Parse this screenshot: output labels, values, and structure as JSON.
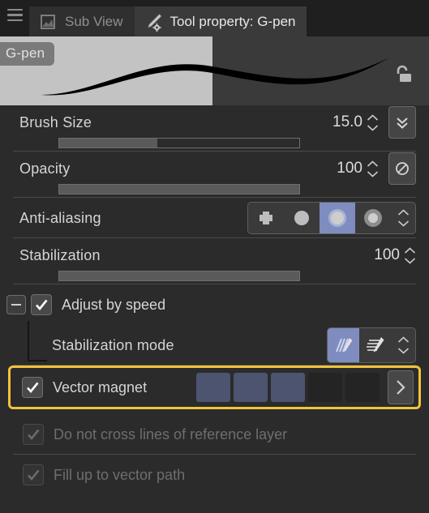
{
  "window": {
    "menu_icon": "hamburger-icon"
  },
  "tabs": [
    {
      "label": "Sub View",
      "icon": "sub-view-icon",
      "active": false
    },
    {
      "label": "Tool property: G-pen",
      "icon": "pencil-gear-icon",
      "active": true
    }
  ],
  "preview": {
    "brush_name": "G-pen",
    "lock_icon": "unlock-icon",
    "left_bg": "#c3c3c3",
    "right_bg": "#3a3a3a",
    "stroke_color": "#000000"
  },
  "properties": [
    {
      "label": "Brush Size",
      "value": "15.0",
      "slider_percent": 41,
      "side_button_icon": "double-chevron-down-icon",
      "has_side_button": true,
      "has_spinner": true
    },
    {
      "label": "Opacity",
      "value": "100",
      "slider_percent": 100,
      "side_button_icon": "no-pressure-icon",
      "has_side_button": true,
      "has_spinner": true
    }
  ],
  "anti_aliasing": {
    "label": "Anti-aliasing",
    "options": [
      {
        "name": "none-icon",
        "selected": false
      },
      {
        "name": "weak-icon",
        "selected": false
      },
      {
        "name": "medium-icon",
        "selected": true
      },
      {
        "name": "strong-icon",
        "selected": false
      }
    ],
    "selected_index": 2,
    "selected_color": "#7e8cc0"
  },
  "stabilization": {
    "label": "Stabilization",
    "value": "100",
    "slider_percent": 100
  },
  "adjust_by_speed": {
    "label": "Adjust by speed",
    "checked": true,
    "expanded": true,
    "collapse_icon": "minus-box-icon"
  },
  "stabilization_mode": {
    "label": "Stabilization mode",
    "options": [
      {
        "name": "stabilizer-lines-icon",
        "selected": true
      },
      {
        "name": "stabilizer-taper-icon",
        "selected": false
      }
    ]
  },
  "vector_magnet": {
    "label": "Vector magnet",
    "checked": true,
    "highlight_color": "#f0c33c",
    "swatches": [
      {
        "name": "swatch-1",
        "filled": true
      },
      {
        "name": "swatch-2",
        "filled": true
      },
      {
        "name": "swatch-3",
        "filled": true
      },
      {
        "name": "swatch-4",
        "filled": false
      },
      {
        "name": "swatch-5",
        "filled": false
      }
    ],
    "swatch_color": "#4d5470",
    "expand_icon": "chevron-right-icon"
  },
  "disabled_options": [
    {
      "label": "Do not cross lines of reference layer",
      "checked": true,
      "enabled": false
    },
    {
      "label": "Fill up to vector path",
      "checked": true,
      "enabled": false
    }
  ]
}
